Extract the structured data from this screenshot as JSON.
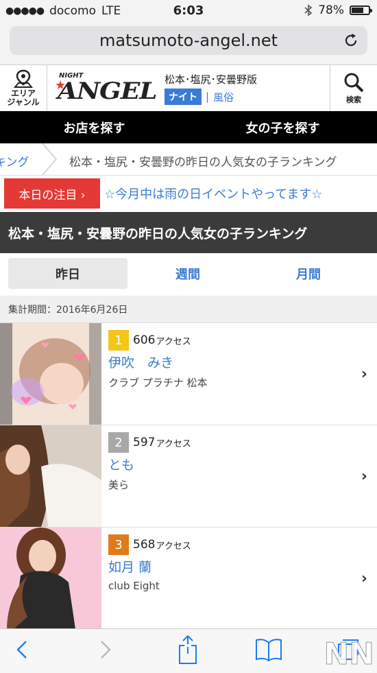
{
  "status_bar": {
    "carrier": "docomo",
    "network": "LTE",
    "time": "6:03",
    "battery": "78%",
    "battery_level": 0.78
  },
  "browser": {
    "url": "matsumoto-angel.net"
  },
  "header": {
    "area_label_1": "エリア",
    "area_label_2": "ジャンル",
    "logo_top": "NIGHT",
    "logo_main": "ANGEL",
    "region": "松本･塩尻･安曇野版",
    "cat_night": "ナイト",
    "cat_sep": "|",
    "cat_fuzoku": "風俗",
    "search_label": "検索"
  },
  "nav": {
    "shops": "お店を探す",
    "girls": "女の子を探す"
  },
  "breadcrumb": {
    "prev": "キング",
    "current": "松本・塩尻・安曇野の昨日の人気女の子ランキング"
  },
  "notice": {
    "tag": "本日の注目 ›",
    "text": "☆今月中は雨の日イベントやってます☆"
  },
  "section_title": "松本・塩尻・安曇野の昨日の人気女の子ランキング",
  "tabs": {
    "yesterday": "昨日",
    "week": "週間",
    "month": "月間"
  },
  "period": "集計期間：2016年6月26日",
  "ranking": [
    {
      "rank": "1",
      "access": "606",
      "unit": "アクセス",
      "name": "伊吹　みき",
      "shop": "クラブ プラチナ 松本",
      "badge_color": "#f5c518"
    },
    {
      "rank": "2",
      "access": "597",
      "unit": "アクセス",
      "name": "とも",
      "shop": "美ら",
      "badge_color": "#a8a8a8"
    },
    {
      "rank": "3",
      "access": "568",
      "unit": "アクセス",
      "name": "如月 蘭",
      "shop": "club Eight",
      "badge_color": "#e07b1a"
    }
  ],
  "watermark": "NN"
}
